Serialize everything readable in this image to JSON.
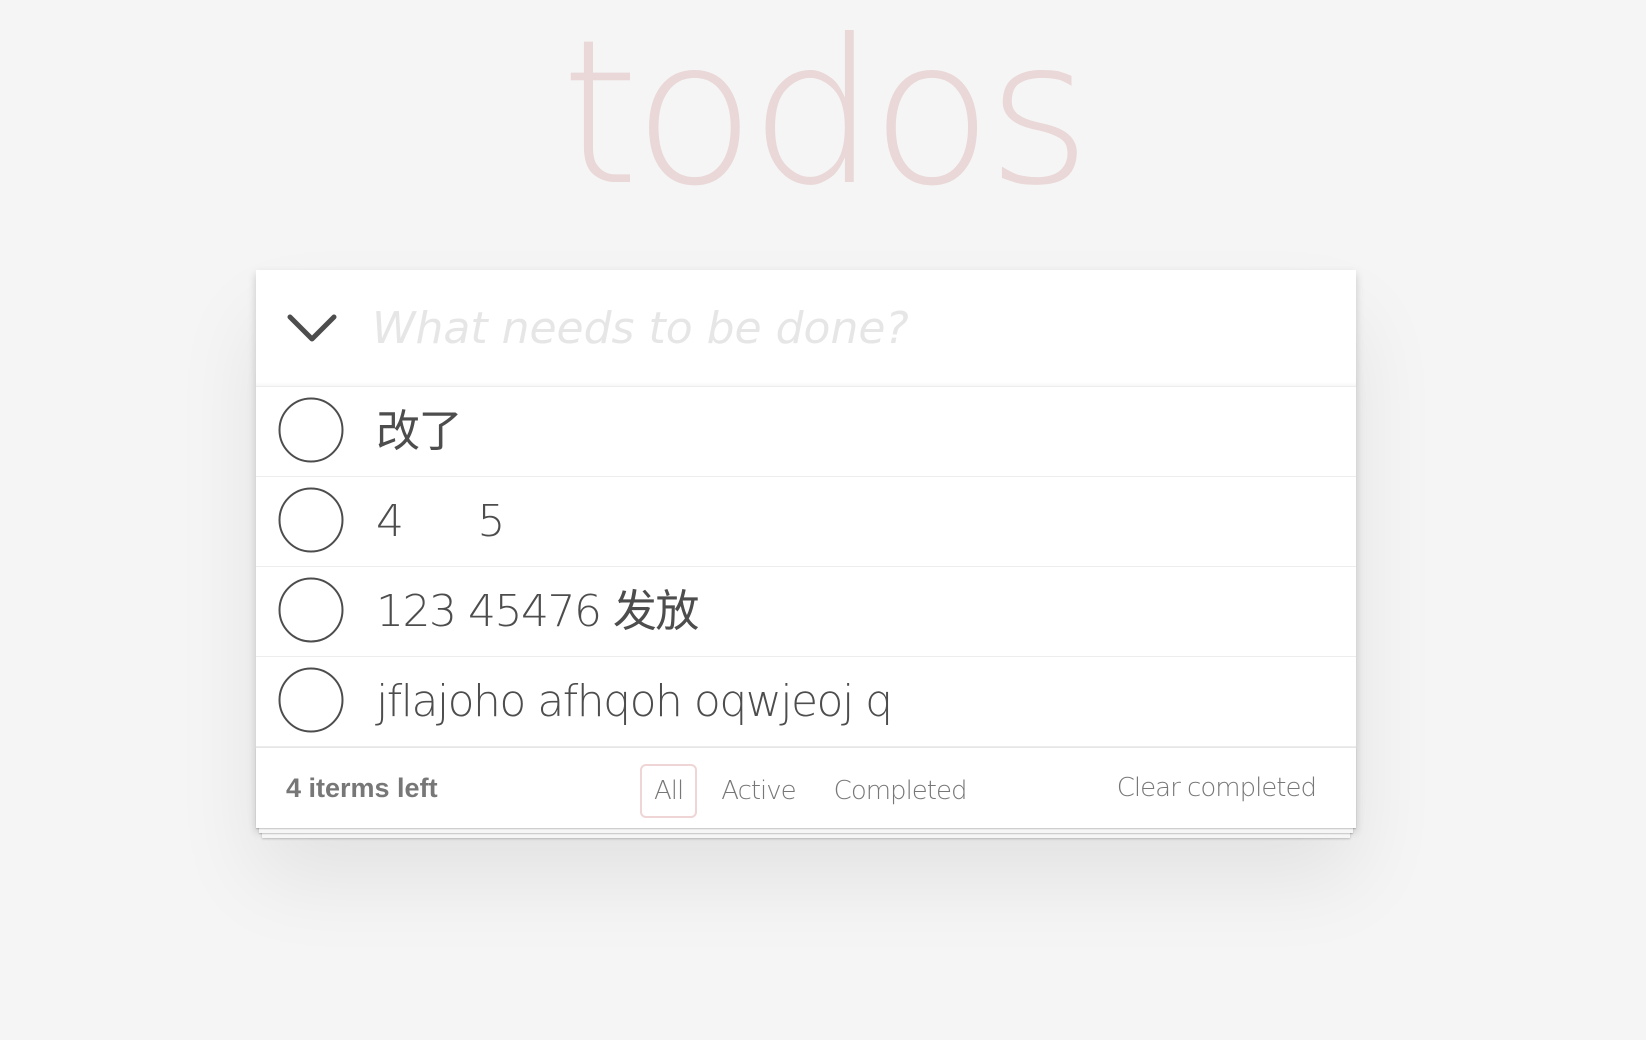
{
  "app": {
    "title": "todos"
  },
  "new_todo": {
    "placeholder": "What needs to be done?",
    "value": ""
  },
  "todos": [
    {
      "label": "改了",
      "completed": false
    },
    {
      "label": "4      5",
      "completed": false
    },
    {
      "label": "123 45476 发放",
      "completed": false
    },
    {
      "label": "jflajoho afhqoh oqwjeoj q",
      "completed": false
    }
  ],
  "footer": {
    "items_left": "4 iterms left",
    "filters": [
      {
        "label": "All",
        "selected": true
      },
      {
        "label": "Active",
        "selected": false
      },
      {
        "label": "Completed",
        "selected": false
      }
    ],
    "clear_completed": "Clear completed"
  },
  "colors": {
    "background": "#f5f5f5",
    "title": "#eadada",
    "text": "#4d4d4d",
    "muted": "#777777",
    "filter_selected_border": "#efd5d5"
  },
  "icons": {
    "toggle_all": "chevron-down-icon",
    "todo_toggle": "circle-checkbox-icon"
  }
}
